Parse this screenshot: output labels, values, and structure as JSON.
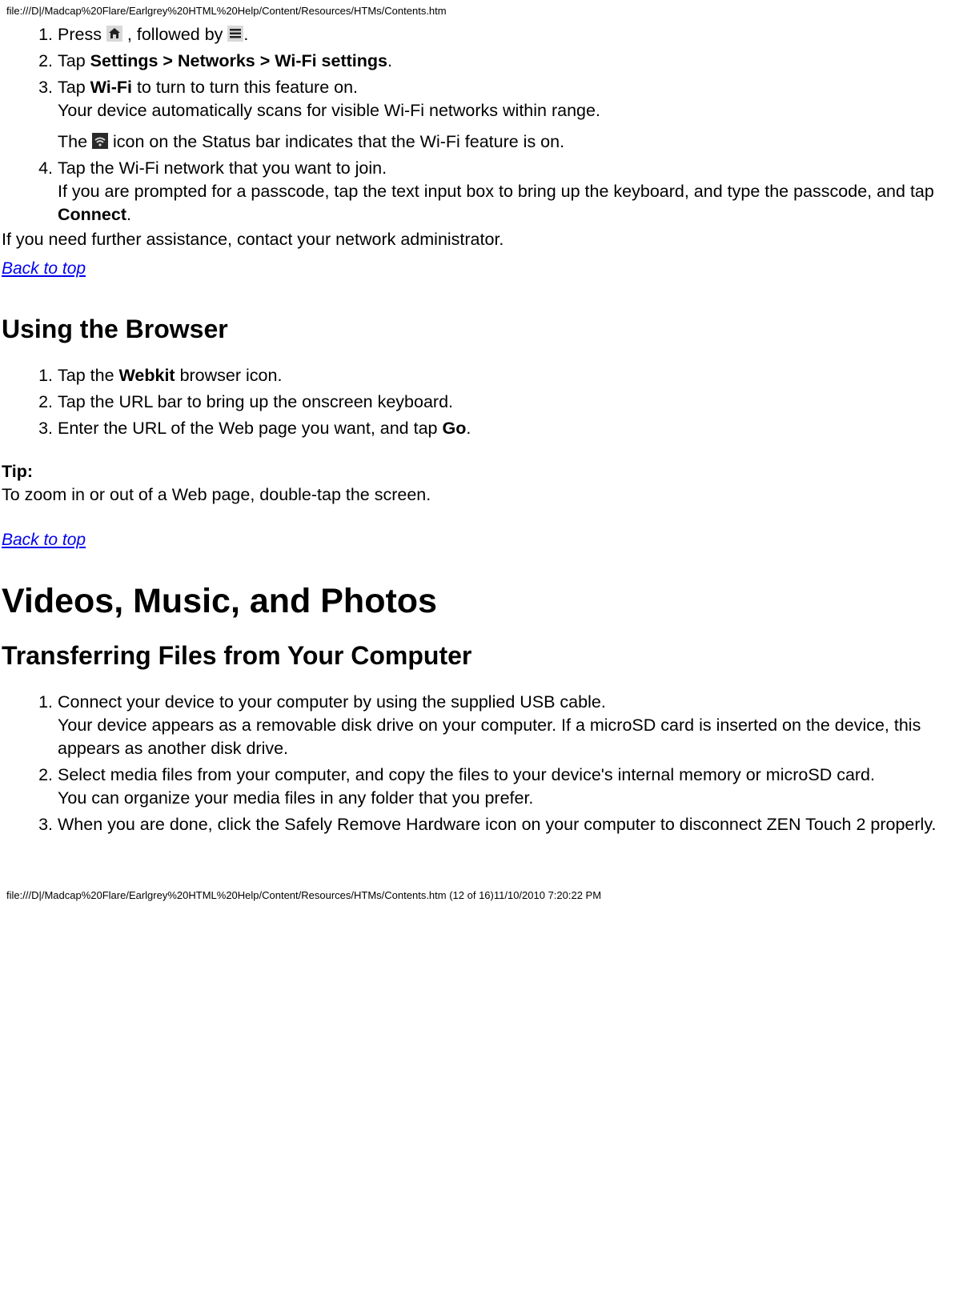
{
  "header_path": "file:///D|/Madcap%20Flare/Earlgrey%20HTML%20Help/Content/Resources/HTMs/Contents.htm",
  "footer_path": "file:///D|/Madcap%20Flare/Earlgrey%20HTML%20Help/Content/Resources/HTMs/Contents.htm (12 of 16)11/10/2010 7:20:22 PM",
  "wifi": {
    "step1_a": "Press ",
    "step1_b": " , followed by ",
    "step1_c": ".",
    "step2_a": "Tap ",
    "step2_b": "Settings > Networks > Wi-Fi settings",
    "step2_c": ".",
    "step3_a": "Tap ",
    "step3_b": "Wi-Fi",
    "step3_c": " to turn to turn this feature on.",
    "step3_d": "Your device automatically scans for visible Wi-Fi networks within range.",
    "step3_e": "The ",
    "step3_f": " icon on the Status bar indicates that the Wi-Fi feature is on.",
    "step4_a": "Tap the Wi-Fi network that you want to join.",
    "step4_b": "If you are prompted for a passcode, tap the text input box to bring up the keyboard, and type the passcode, and tap ",
    "step4_c": "Connect",
    "step4_d": ".",
    "assist": "If you need further assistance, contact your network administrator."
  },
  "back_to_top": "Back to top",
  "browser": {
    "heading": "Using the Browser",
    "step1_a": "Tap the ",
    "step1_b": "Webkit",
    "step1_c": " browser icon.",
    "step2": "Tap the URL bar to bring up the onscreen keyboard.",
    "step3_a": "Enter the URL of the Web page you want, and tap ",
    "step3_b": "Go",
    "step3_c": ".",
    "tip_label": "Tip:",
    "tip_text": "To zoom in or out of a Web page, double-tap the screen."
  },
  "media": {
    "heading": "Videos, Music, and Photos",
    "subheading": "Transferring Files from Your Computer",
    "step1_a": "Connect your device to your computer by using the supplied USB cable.",
    "step1_b": "Your device appears as a removable disk drive on your computer. If a microSD card is inserted on the device, this appears as another disk drive.",
    "step2_a": "Select media files from your computer, and copy the files to your device's internal memory or microSD card.",
    "step2_b": "You can organize your media files in any folder that you prefer.",
    "step3": "When you are done, click the Safely Remove Hardware icon on your computer to disconnect ZEN Touch 2 properly."
  }
}
